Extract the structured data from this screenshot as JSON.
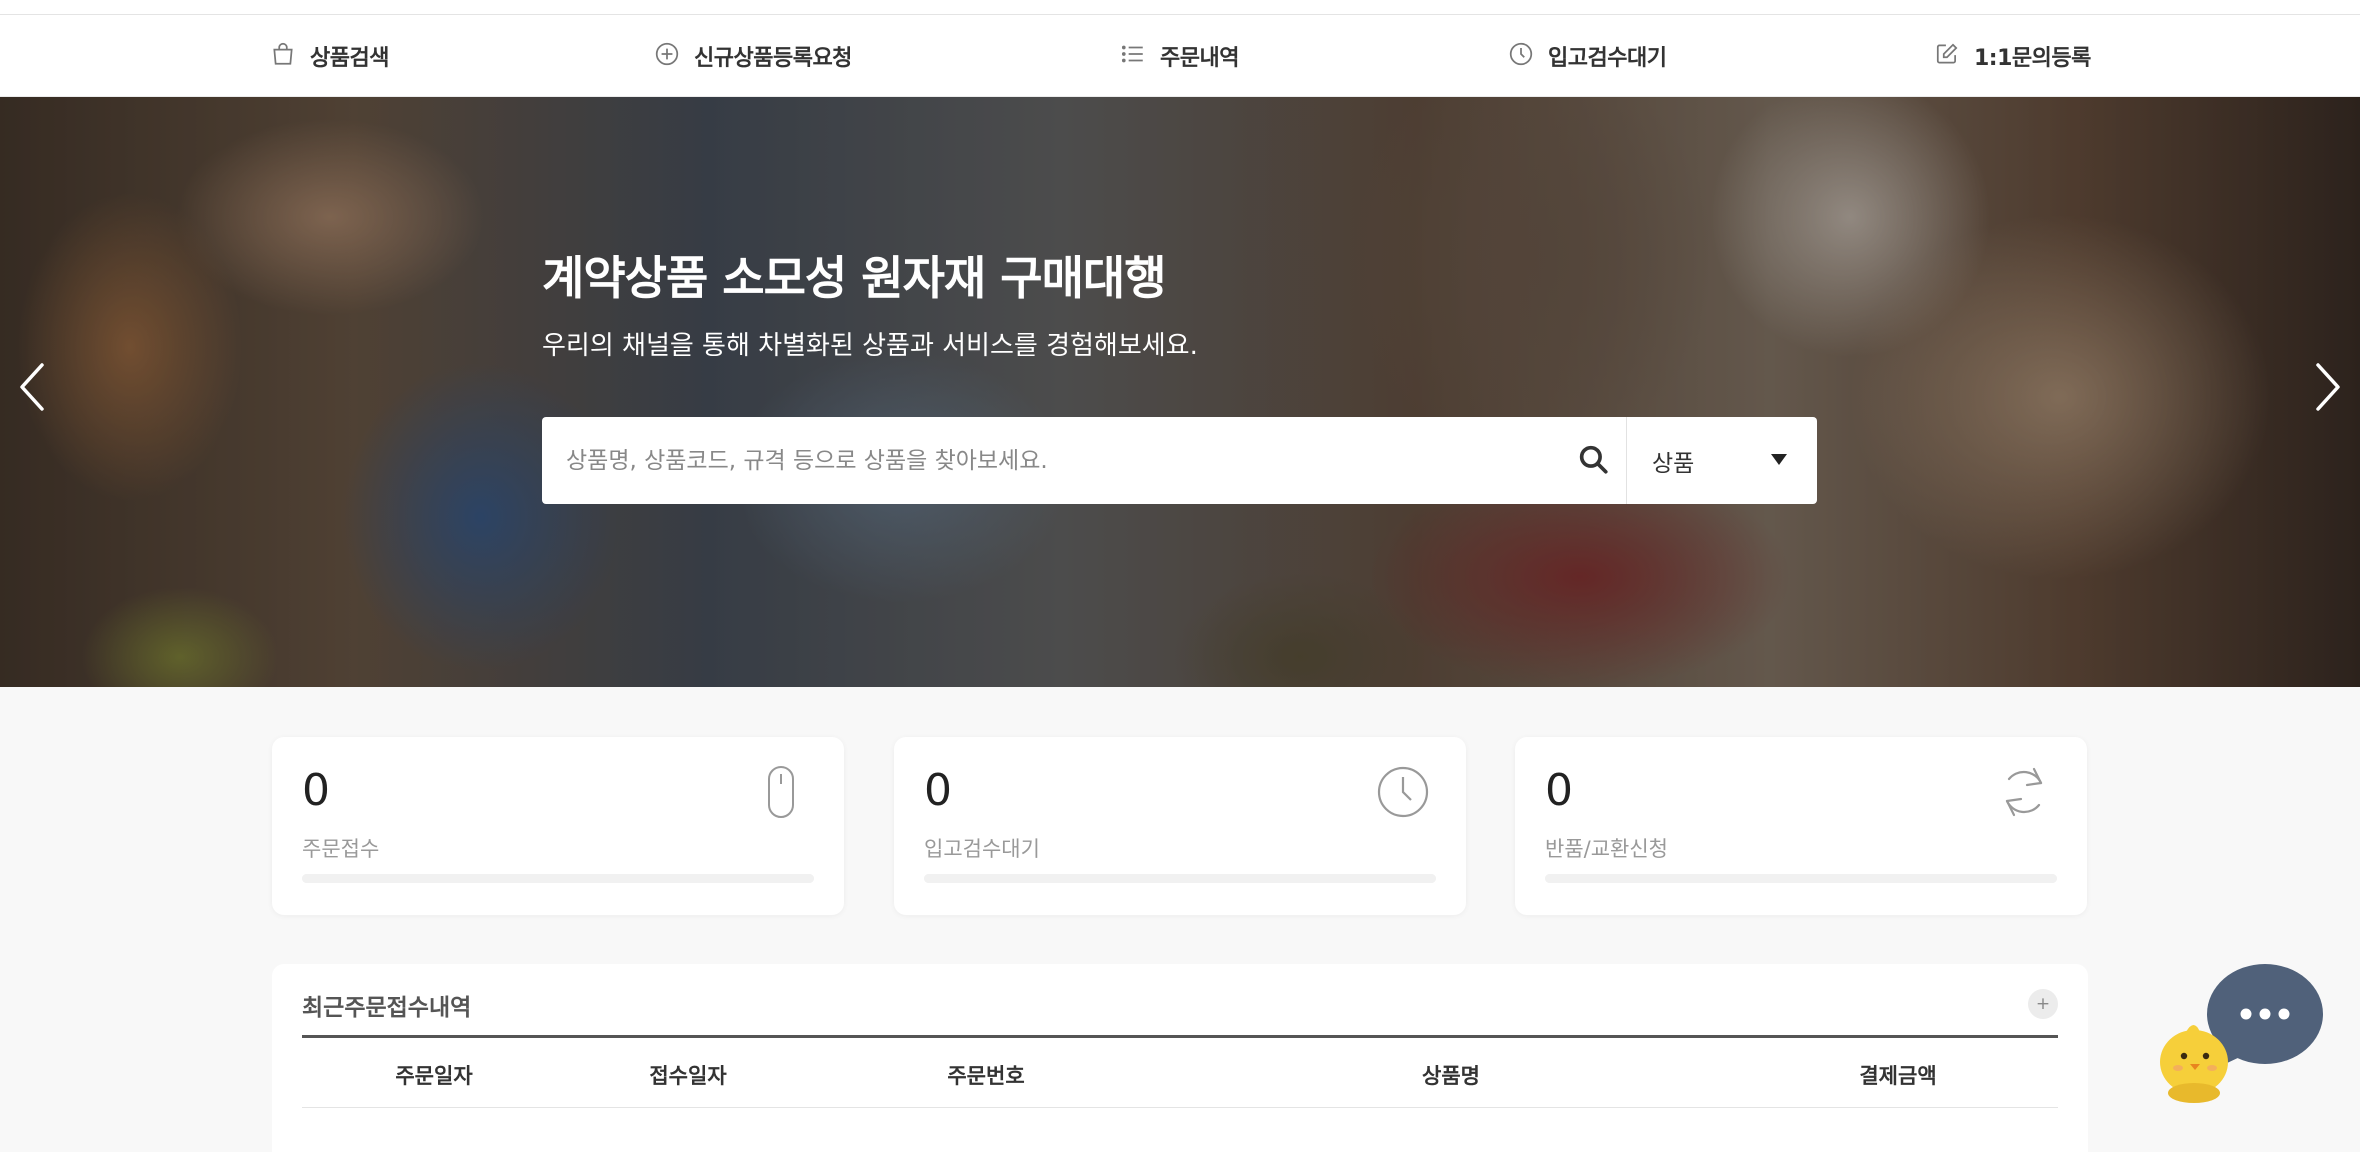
{
  "nav": {
    "items": [
      {
        "label": "상품검색",
        "icon": "shopping-bag-icon"
      },
      {
        "label": "신규상품등록요청",
        "icon": "plus-circle-icon"
      },
      {
        "label": "주문내역",
        "icon": "list-icon"
      },
      {
        "label": "입고검수대기",
        "icon": "clock-icon"
      },
      {
        "label": "1:1문의등록",
        "icon": "edit-icon"
      }
    ]
  },
  "hero": {
    "title": "계약상품 소모성 원자재 구매대행",
    "subtitle": "우리의 채널을 통해 차별화된 상품과 서비스를 경험해보세요.",
    "search": {
      "placeholder": "상품명, 상품코드, 규격 등으로 상품을 찾아보세요.",
      "value": "",
      "category": "상품"
    }
  },
  "stats": [
    {
      "value": "0",
      "label": "주문접수",
      "icon": "mouse-icon"
    },
    {
      "value": "0",
      "label": "입고검수대기",
      "icon": "clock-icon"
    },
    {
      "value": "0",
      "label": "반품/교환신청",
      "icon": "refresh-icon"
    }
  ],
  "recent_orders": {
    "title": "최근주문접수내역",
    "more_label": "+",
    "columns": [
      "주문일자",
      "접수일자",
      "주문번호",
      "상품명",
      "결제금액"
    ]
  },
  "colors": {
    "nav_background": "#ffffff",
    "page_background": "#f8f8f8",
    "chat_bubble": "#50617a",
    "mascot": "#f6cf3a"
  }
}
